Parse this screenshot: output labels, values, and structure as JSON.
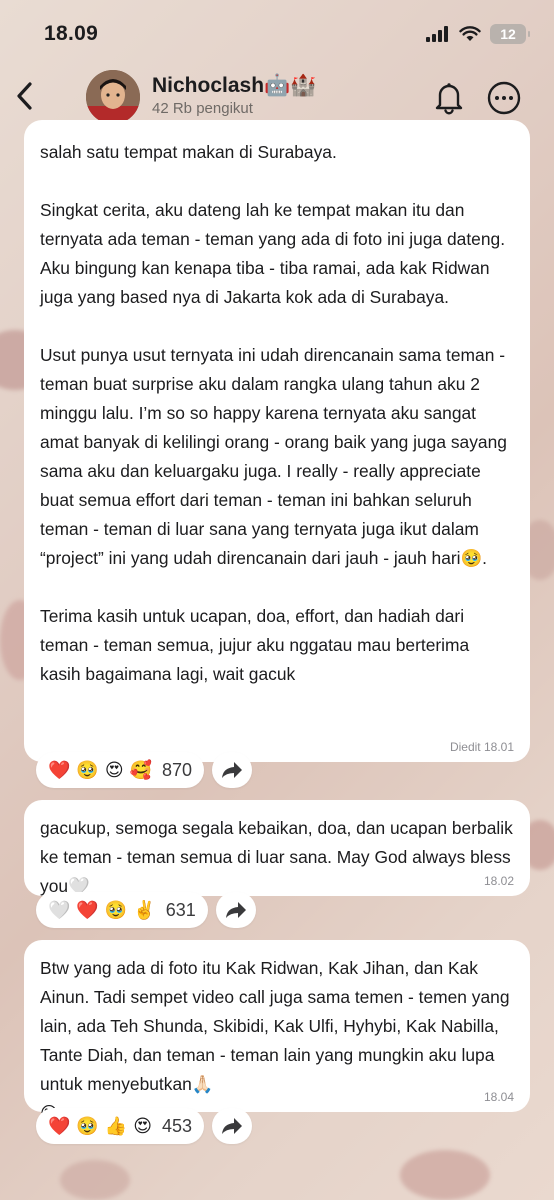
{
  "status": {
    "time": "18.09",
    "battery": "12"
  },
  "header": {
    "name": "Nichoclash🤖🏰",
    "followers": "42 Rb pengikut"
  },
  "messages": [
    {
      "text": "salah satu tempat makan di Surabaya.\n\nSingkat cerita, aku dateng lah ke tempat makan itu dan ternyata ada teman - teman yang ada di foto ini juga dateng.  Aku bingung kan kenapa tiba - tiba ramai, ada kak Ridwan juga yang based nya di Jakarta kok ada di Surabaya.\n\nUsut punya usut ternyata ini udah direncanain sama teman - teman buat surprise aku dalam rangka ulang tahun aku 2 minggu lalu. I’m so so happy karena ternyata aku sangat amat banyak di kelilingi orang - orang baik yang juga sayang sama aku dan keluargaku juga. I really - really appreciate buat semua effort dari teman - teman ini bahkan seluruh teman - teman di luar sana yang ternyata juga ikut dalam “project” ini yang udah direncanain dari jauh - jauh hari🥹.\n\nTerima kasih untuk ucapan, doa, effort, dan hadiah dari teman - teman semua, jujur aku nggatau mau berterima kasih bagaimana lagi, wait gacuk",
      "meta": "Diedit 18.01",
      "reactions": [
        "❤️",
        "🥹",
        "😍",
        "🥰"
      ],
      "count": "870"
    },
    {
      "text": "gacukup, semoga segala kebaikan, doa, dan ucapan berbalik ke teman - teman semua di luar sana. May God always bless you🤍",
      "meta": "18.02",
      "reactions": [
        "🤍",
        "❤️",
        "🥹",
        "✌️"
      ],
      "count": "631"
    },
    {
      "text": "Btw yang ada di foto itu Kak Ridwan, Kak Jihan, dan Kak Ainun. Tadi sempet video call juga sama temen - temen yang lain, ada Teh Shunda, Skibidi, Kak Ulfi, Hyhybi, Kak Nabilla, Tante Diah, dan teman - teman lain yang mungkin aku lupa untuk menyebutkan🙏🏻\n😁",
      "meta": "18.04",
      "reactions": [
        "❤️",
        "🥹",
        "👍",
        "😍"
      ],
      "count": "453"
    }
  ]
}
